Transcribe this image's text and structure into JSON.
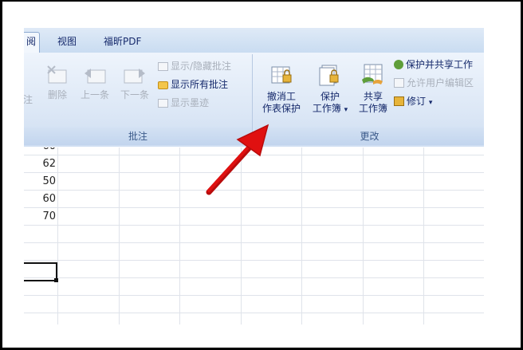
{
  "tabs": [
    {
      "label": "阅",
      "active": true
    },
    {
      "label": "视图",
      "active": false
    },
    {
      "label": "福昕PDF",
      "active": false
    }
  ],
  "comments_group": {
    "label": "批注",
    "buttons": {
      "prev_cut": "注",
      "delete": "删除",
      "previous": "上一条",
      "next": "下一条"
    },
    "small_items": [
      {
        "label": "显示/隐藏批注",
        "enabled": false
      },
      {
        "label": "显示所有批注",
        "enabled": true
      },
      {
        "label": "显示墨迹",
        "enabled": false
      }
    ]
  },
  "changes_group": {
    "label": "更改",
    "unprotect_sheet": {
      "line1": "撤消工",
      "line2": "作表保护"
    },
    "protect_workbook": {
      "line1": "保护",
      "line2": "工作簿",
      "dropdown": "▾"
    },
    "share_workbook": {
      "line1": "共享",
      "line2": "工作簿"
    },
    "small_items": [
      {
        "label": "保护并共享工作",
        "enabled": true
      },
      {
        "label": "允许用户编辑区",
        "enabled": false
      },
      {
        "label": "修订",
        "enabled": true,
        "dropdown": "▾"
      }
    ]
  },
  "sheet": {
    "values": [
      "60",
      "62",
      "50",
      "60",
      "70"
    ]
  },
  "colors": {
    "accent_arrow": "#e01010",
    "ribbon_text": "#15296b"
  }
}
